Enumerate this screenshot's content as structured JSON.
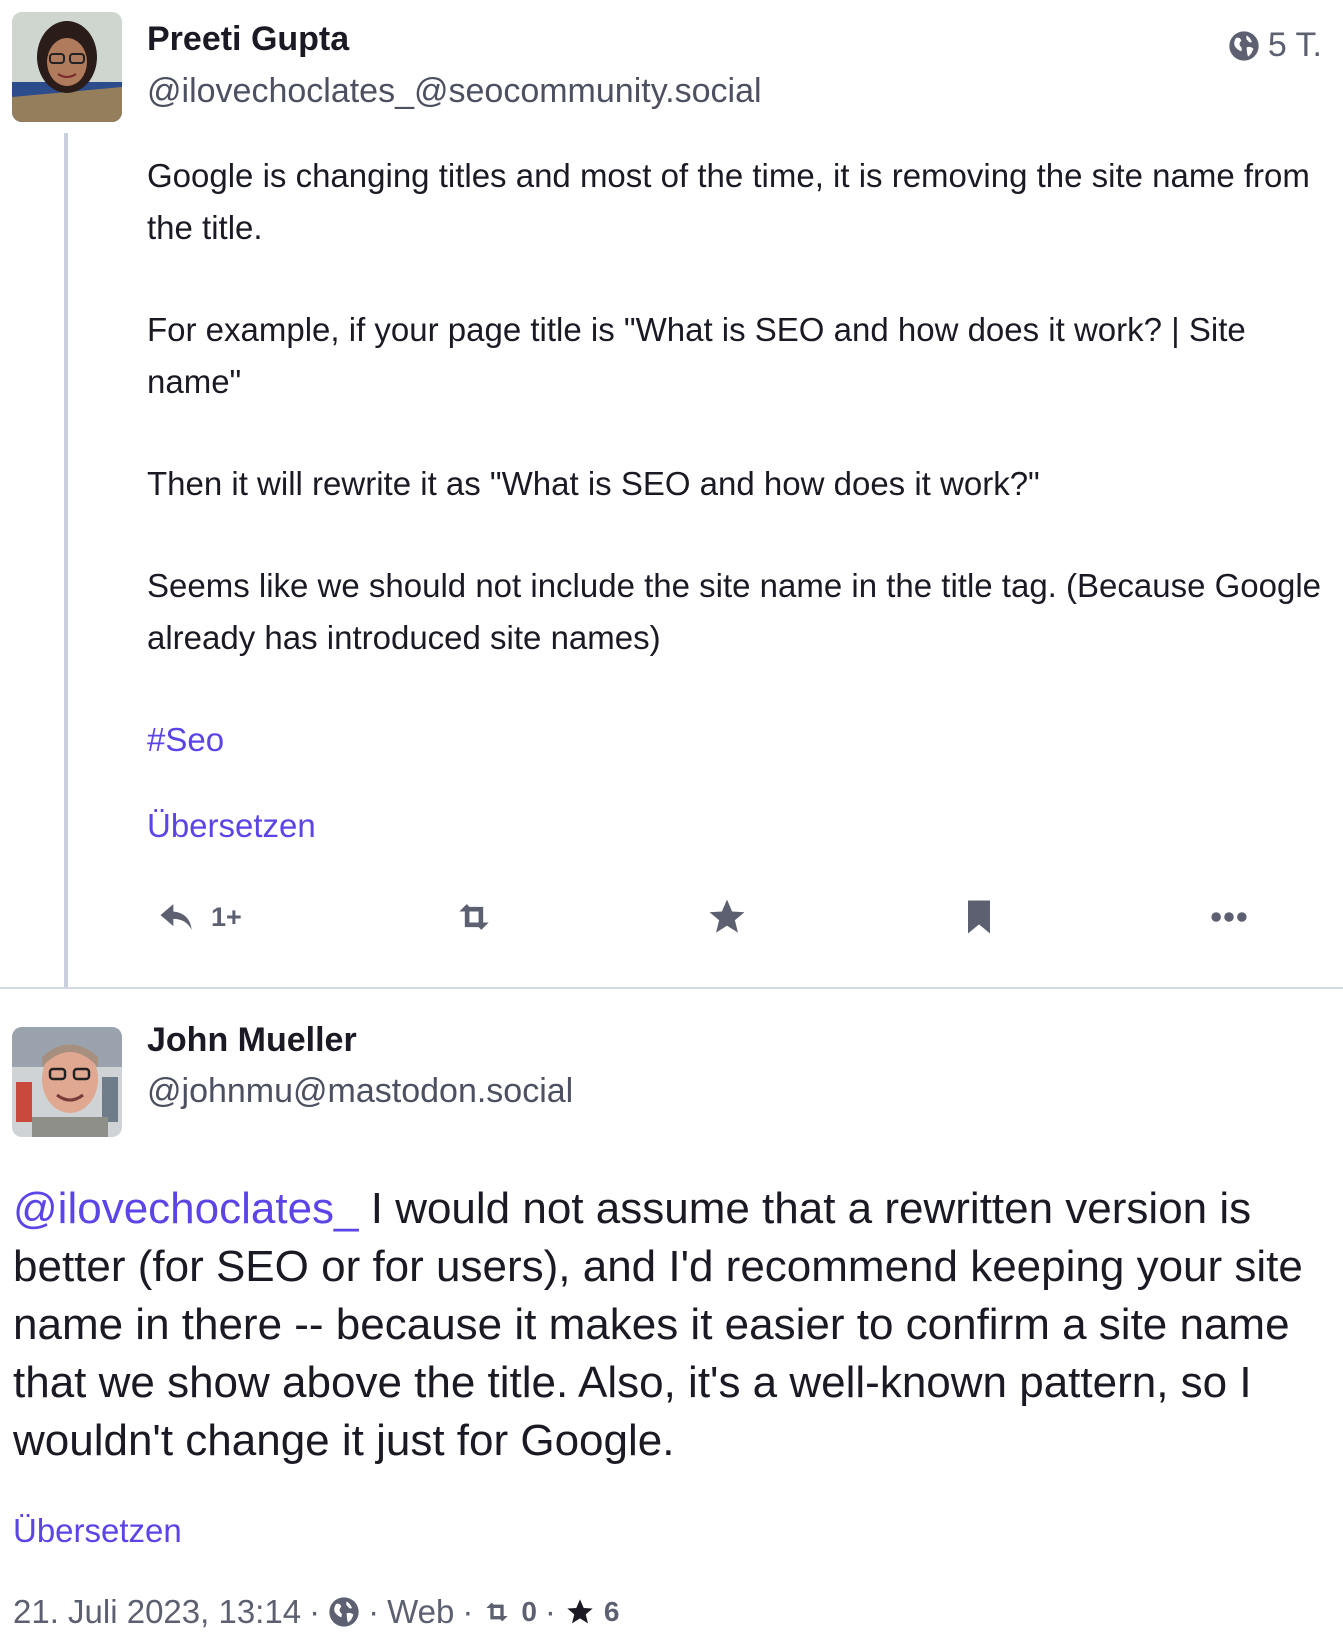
{
  "post1": {
    "author": "Preeti Gupta",
    "handle": "@ilovechoclates_@seocommunity.social",
    "visibility_icon": "globe-icon",
    "time": "5 T.",
    "paragraphs": [
      "Google is changing titles and most of the time, it is removing the site name from the title.",
      "For example, if your page title is \"What is SEO and how does it work? | Site name\"",
      "Then it will rewrite it as \"What is SEO and how does it work?\"",
      "Seems like we should not include the site name in the title tag. (Because Google already has introduced site names)"
    ],
    "hashtag": "#Seo",
    "translate": "Übersetzen",
    "actions": {
      "reply_count": "1+",
      "icons": [
        "reply-icon",
        "boost-icon",
        "favourite-icon",
        "bookmark-icon",
        "more-icon"
      ]
    }
  },
  "post2": {
    "author": "John Mueller",
    "handle": "@johnmu@mastodon.social",
    "mention": "@ilovechoclates_",
    "text": " I would not assume that a rewritten version is better (for SEO or for users), and I'd recommend keeping your site name in there -- because it makes it easier to confirm a site name that we show above the title. Also, it's a well-known pattern, so I wouldn't change it just for Google.",
    "translate": "Übersetzen",
    "meta": {
      "date": "21. Juli 2023, 13:14",
      "sep": "·",
      "client": "Web",
      "boosts": "0",
      "favourites": "6"
    }
  },
  "colors": {
    "accent": "#5b45e6",
    "text": "#1b1a24",
    "muted": "#5c6070",
    "divider": "#d4d9e3"
  }
}
